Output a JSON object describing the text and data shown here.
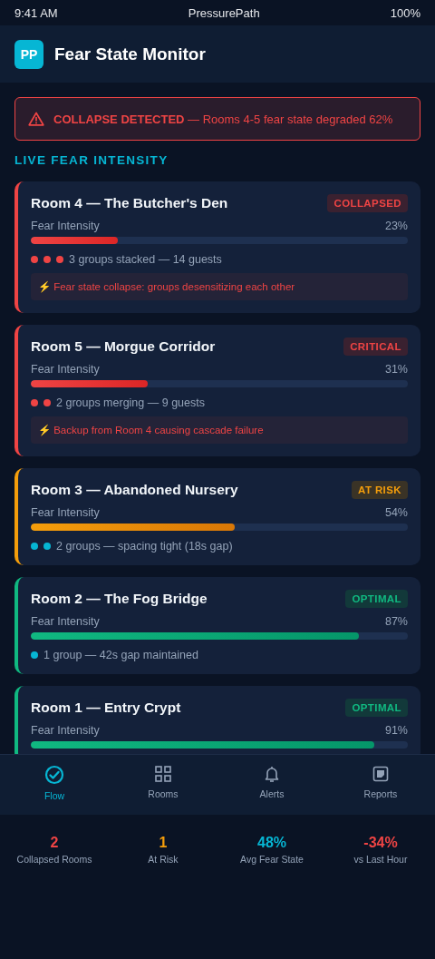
{
  "status_bar": {
    "time": "9:41 AM",
    "app": "PressurePath",
    "battery": "100%"
  },
  "header": {
    "logo": "PP",
    "title": "Fear State Monitor"
  },
  "alert": {
    "text": "**COLLAPSE DETECTED** — Rooms 4-5 fear state degraded 62%"
  },
  "section_title": "LIVE FEAR INTENSITY",
  "rooms": [
    {
      "title": "Room 4 — The Butcher's Den",
      "status": "COLLAPSED",
      "kind": "collapsed",
      "metric": "Fear Intensity",
      "reading": "23%",
      "level": 0.23,
      "dots": [
        {
          "color": "#ef4444"
        },
        {
          "color": "#ef4444"
        },
        {
          "color": "#ef4444"
        }
      ],
      "groups": "3 groups stacked — 14 guests",
      "note": "⚡ Fear state collapse: groups desensitizing each other"
    },
    {
      "title": "Room 5 — Morgue Corridor",
      "status": "CRITICAL",
      "kind": "critical",
      "metric": "Fear Intensity",
      "reading": "31%",
      "level": 0.31,
      "dots": [
        {
          "color": "#ef4444"
        },
        {
          "color": "#ef4444"
        }
      ],
      "groups": "2 groups merging — 9 guests",
      "note": "⚡ Backup from Room 4 causing cascade failure"
    },
    {
      "title": "Room 3 — Abandoned Nursery",
      "status": "AT RISK",
      "kind": "at_risk",
      "metric": "Fear Intensity",
      "reading": "54%",
      "level": 0.54,
      "dots": [
        {
          "color": "#06b6d4"
        },
        {
          "color": "#06b6d4"
        }
      ],
      "groups": "2 groups — spacing tight (18s gap)"
    },
    {
      "title": "Room 2 — The Fog Bridge",
      "status": "OPTIMAL",
      "kind": "optimal",
      "metric": "Fear Intensity",
      "reading": "87%",
      "level": 0.87,
      "dots": [
        {
          "color": "#06b6d4"
        }
      ],
      "groups": "1 group — 42s gap maintained"
    },
    {
      "title": "Room 1 — Entry Crypt",
      "status": "OPTIMAL",
      "kind": "optimal",
      "metric": "Fear Intensity",
      "reading": "91%",
      "level": 0.91
    }
  ],
  "nav": [
    {
      "label": "Flow",
      "kind": "flow",
      "selected": true
    },
    {
      "label": "Rooms",
      "kind": "rooms",
      "selected": false
    },
    {
      "label": "Alerts",
      "kind": "alerts",
      "selected": false
    },
    {
      "label": "Reports",
      "kind": "reports",
      "selected": false
    }
  ],
  "stats": [
    {
      "value": "2",
      "label": "Collapsed Rooms",
      "color": "#ef4444"
    },
    {
      "value": "1",
      "label": "At Risk",
      "color": "#f59e0b"
    },
    {
      "value": "48%",
      "label": "Avg Fear State",
      "color": "#06b6d4"
    },
    {
      "value": "-34%",
      "label": "vs Last Hour",
      "color": "#ef4444"
    }
  ]
}
